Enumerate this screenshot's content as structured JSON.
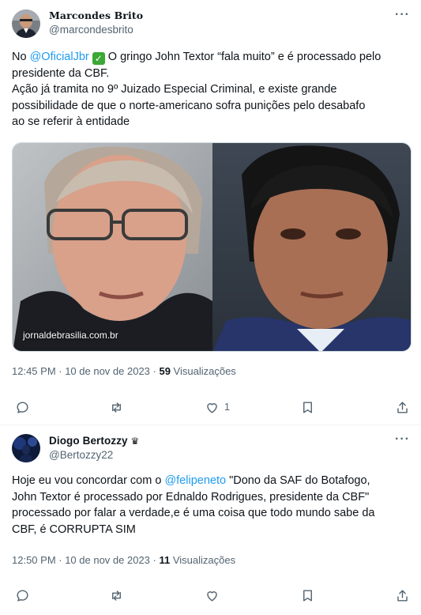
{
  "tweet1": {
    "author_name": "Marcondes Brito",
    "handle": "@marcondesbrito",
    "more": "···",
    "text": {
      "prefix": "No ",
      "mention": "@OficialJbr",
      "check": "✓",
      "line1_rest": "  O  gringo John Textor “fala muito” e é processado pelo",
      "line2": "presidente da CBF.",
      "line3": "Ação já tramita no 9º Juizado Especial Criminal, e existe grande",
      "line4": "possibilidade de que o norte-americano sofra punições pelo desabafo",
      "line5": "ao se referir à entidade"
    },
    "media_watermark": "jornaldebrasilia.com.br",
    "time": "12:45 PM · 10 de nov de 2023 · ",
    "views_count": "59",
    "views_label": " Visualizações",
    "like_count": "1"
  },
  "tweet2": {
    "author_name": "Diogo Bertozzy",
    "crown": "♛",
    "handle": "@Bertozzy22",
    "more": "···",
    "text": {
      "line1_prefix": "Hoje eu vou concordar com o ",
      "mention": "@felipeneto",
      "line1_rest": "  \"Dono da SAF do Botafogo,",
      "line2": "John Textor é processado por Ednaldo Rodrigues, presidente da CBF\"",
      "line3": "processado por falar a verdade,e é uma coisa que todo mundo sabe da",
      "line4": "CBF, é CORRUPTA SIM"
    },
    "time": "12:50 PM · 10 de nov de 2023 · ",
    "views_count": "11",
    "views_label": " Visualizações"
  },
  "colors": {
    "link": "#1d9bf0",
    "muted": "#536471",
    "text": "#0f1419",
    "verified_check": "#3ca836"
  },
  "icons": [
    "reply-icon",
    "retweet-icon",
    "like-icon",
    "bookmark-icon",
    "share-icon",
    "more-icon"
  ]
}
